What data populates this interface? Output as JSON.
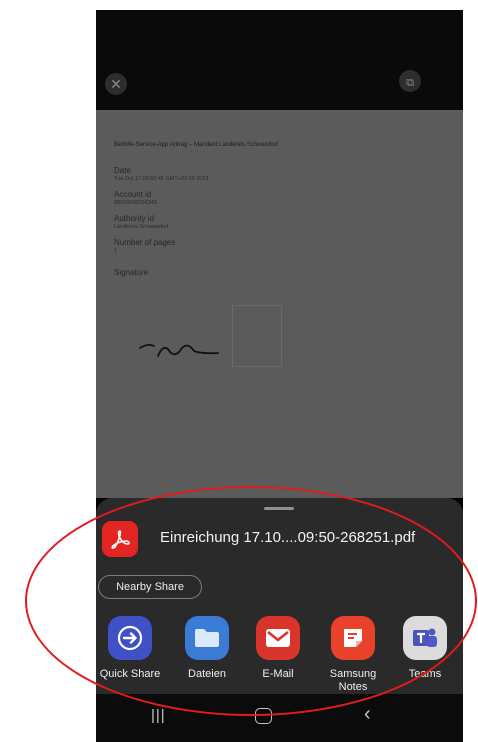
{
  "document": {
    "title": "Beihilfe-Service-App Antrag – Mandant Landkreis Schwandorf",
    "fields": [
      {
        "label": "Date",
        "value": "Tue Oct 17 09:50:45 GMT+02:00 2023"
      },
      {
        "label": "Account id",
        "value": "88000000038343"
      },
      {
        "label": "Authority id",
        "value": "Landkreis Schwandorf"
      },
      {
        "label": "Number of pages",
        "value": "1"
      }
    ],
    "signature_label": "Signature"
  },
  "share_sheet": {
    "file_name": "Einreichung 17.10....09:50-268251.pdf",
    "nearby_share_label": "Nearby Share",
    "apps": [
      {
        "label": "Quick Share",
        "icon": "quick-share-icon",
        "color": "#3f51c7"
      },
      {
        "label": "Dateien",
        "icon": "folder-icon",
        "color": "#3a7bd5"
      },
      {
        "label": "E-Mail",
        "icon": "mail-icon",
        "color": "#d8342c"
      },
      {
        "label": "Samsung Notes",
        "icon": "notes-icon",
        "color": "#e8422b"
      },
      {
        "label": "Teams",
        "icon": "teams-icon",
        "color": "#dcdcdc"
      }
    ]
  },
  "colors": {
    "annotation": "#e21b1b",
    "sheet_background": "#2a2a2a",
    "pdf_red": "#e32622"
  }
}
